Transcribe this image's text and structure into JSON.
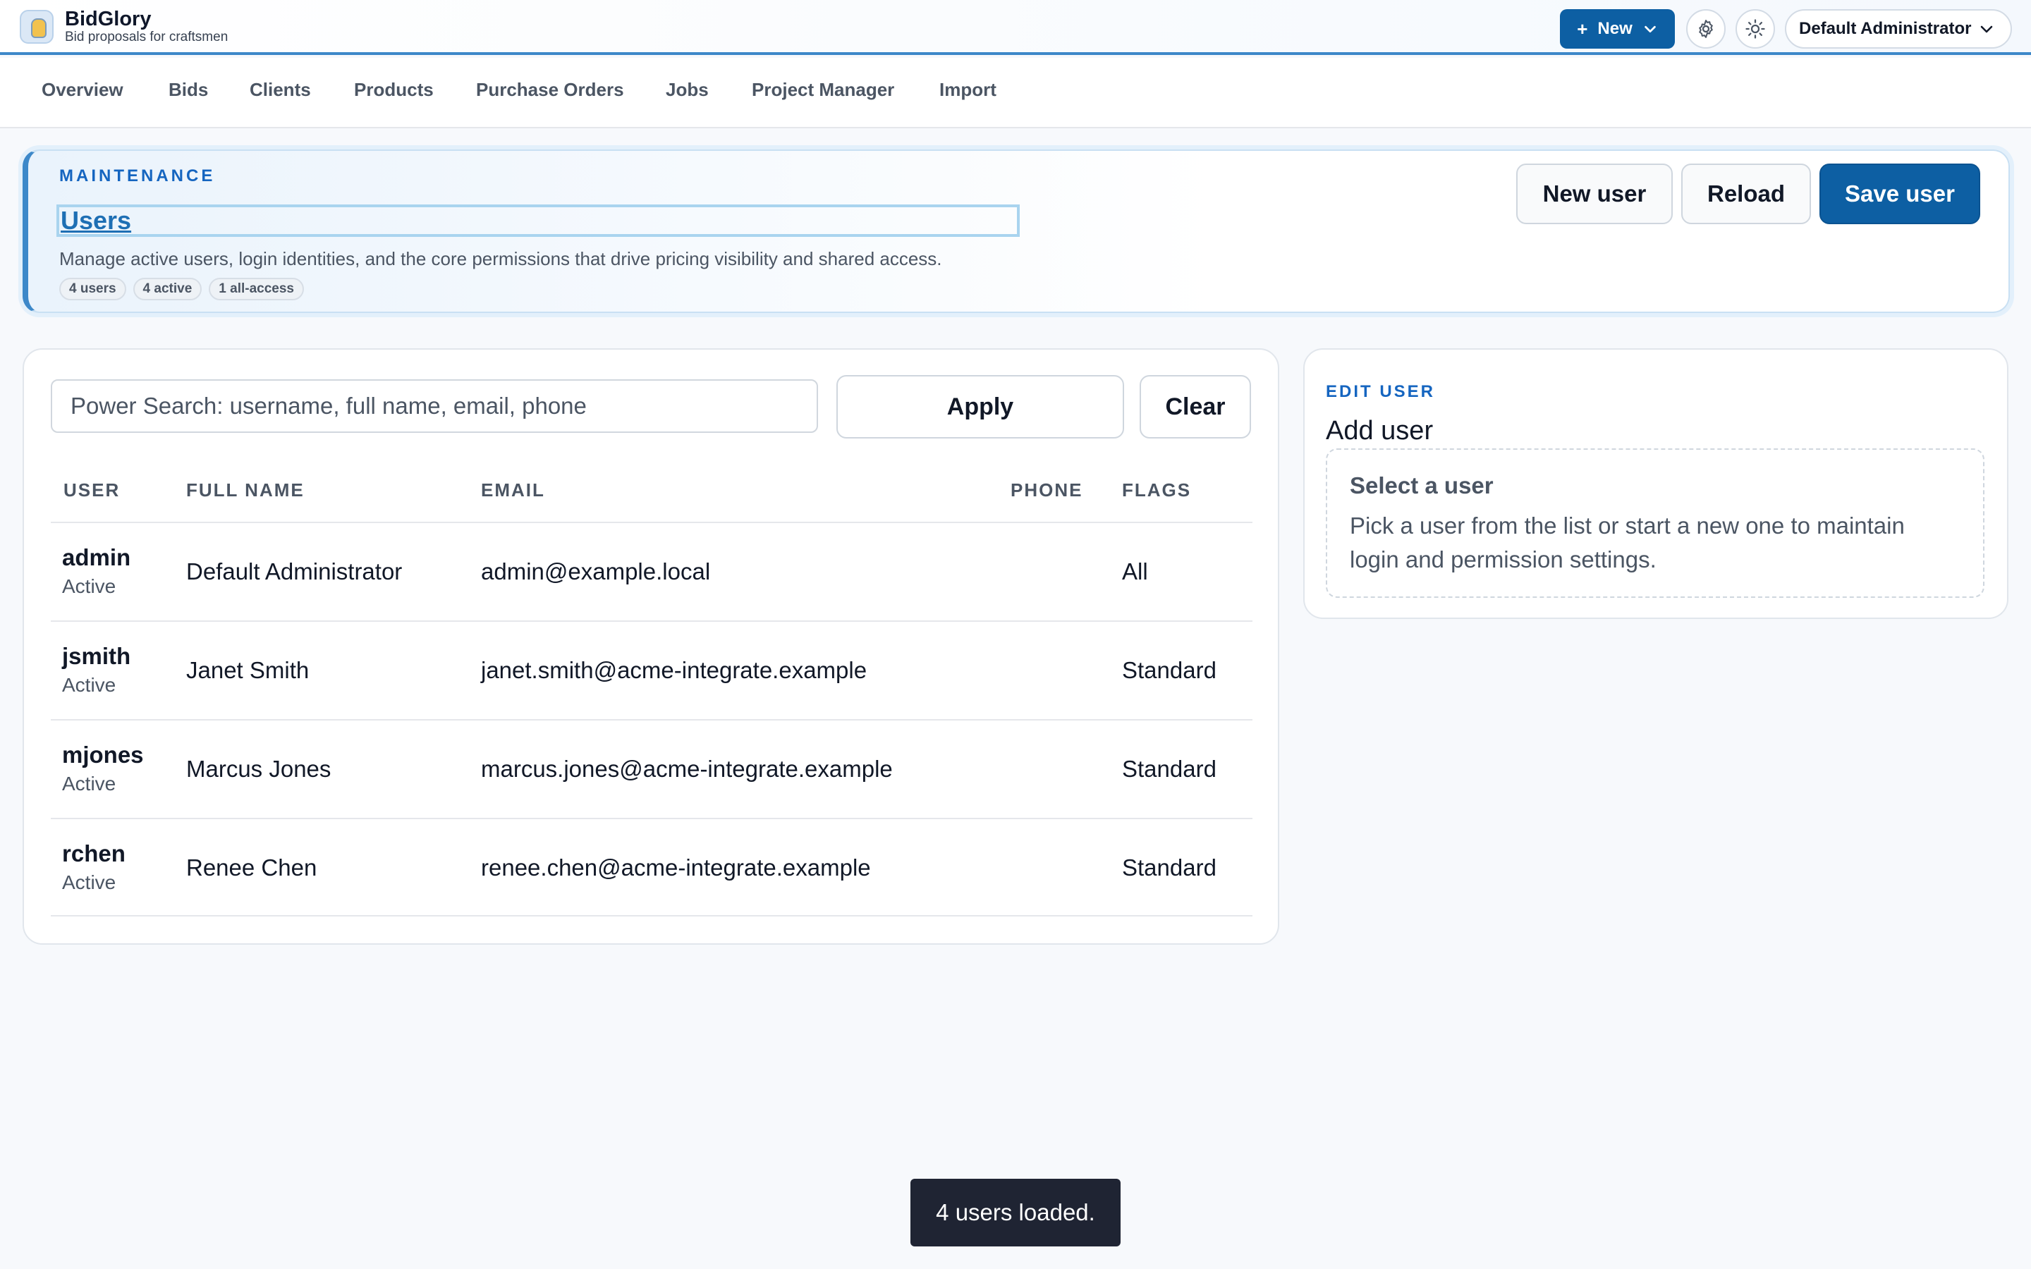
{
  "app": {
    "name": "BidGlory",
    "tagline": "Bid proposals for craftsmen"
  },
  "header": {
    "new_button_label": "New",
    "settings_icon": "gear-icon",
    "theme_icon": "sun-icon",
    "user_menu_label": "Default Administrator"
  },
  "nav": {
    "items": [
      "Overview",
      "Bids",
      "Clients",
      "Products",
      "Purchase Orders",
      "Jobs",
      "Project Manager",
      "Import"
    ]
  },
  "page": {
    "eyebrow": "MAINTENANCE",
    "title": "Users",
    "description": "Manage active users, login identities, and the core permissions that drive pricing visibility and shared access.",
    "badges": [
      "4 users",
      "4 active",
      "1 all-access"
    ],
    "buttons": {
      "new_user": "New user",
      "reload": "Reload",
      "save_user": "Save user"
    }
  },
  "list": {
    "search_placeholder": "Power Search: username, full name, email, phone",
    "search_value": "",
    "apply_label": "Apply",
    "clear_label": "Clear",
    "columns": [
      "USER",
      "FULL NAME",
      "EMAIL",
      "PHONE",
      "FLAGS"
    ],
    "rows": [
      {
        "username": "admin",
        "status": "Active",
        "full_name": "Default Administrator",
        "email": "admin@example.local",
        "phone": "",
        "flags": "All"
      },
      {
        "username": "jsmith",
        "status": "Active",
        "full_name": "Janet Smith",
        "email": "janet.smith@acme-integrate.example",
        "phone": "",
        "flags": "Standard"
      },
      {
        "username": "mjones",
        "status": "Active",
        "full_name": "Marcus Jones",
        "email": "marcus.jones@acme-integrate.example",
        "phone": "",
        "flags": "Standard"
      },
      {
        "username": "rchen",
        "status": "Active",
        "full_name": "Renee Chen",
        "email": "renee.chen@acme-integrate.example",
        "phone": "",
        "flags": "Standard"
      }
    ]
  },
  "edit": {
    "eyebrow": "EDIT USER",
    "title": "Add user",
    "empty_title": "Select a user",
    "empty_description": "Pick a user from the list or start a new one to maintain login and permission settings."
  },
  "toast": {
    "message": "4 users loaded."
  },
  "colors": {
    "accent": "#0d5fa3",
    "accent_light": "#3d88c9",
    "text": "#111827",
    "muted": "#4b5563",
    "toast_bg": "#1f2433"
  }
}
